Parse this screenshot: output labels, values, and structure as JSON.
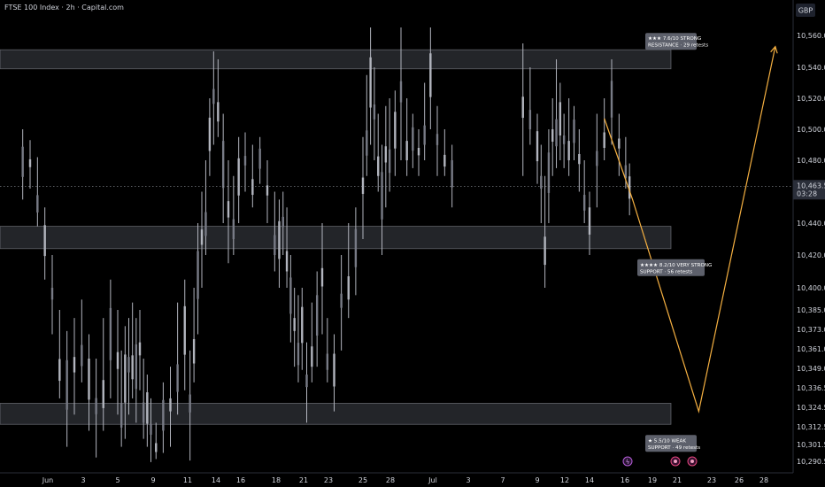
{
  "header": {
    "title": "FTSE 100 Index · 2h · Capital.com"
  },
  "currency": "GBP",
  "colors": {
    "background": "#000000",
    "candle": "#b2b5be",
    "projection": "#f5b041",
    "zone": "#5d606b",
    "label_bg": "#5d606b"
  },
  "price_axis": {
    "labels": [
      {
        "text": "10,560.0",
        "v": 10560.0
      },
      {
        "text": "10,540.0",
        "v": 10540.0
      },
      {
        "text": "10,520.0",
        "v": 10520.0
      },
      {
        "text": "10,500.0",
        "v": 10500.0
      },
      {
        "text": "10,480.0",
        "v": 10480.0
      },
      {
        "text": "10,440.0",
        "v": 10440.0
      },
      {
        "text": "10,420.0",
        "v": 10420.0
      },
      {
        "text": "10,400.0",
        "v": 10400.0
      },
      {
        "text": "10,385.0",
        "v": 10385.0
      },
      {
        "text": "10,373.0",
        "v": 10373.0
      },
      {
        "text": "10,361.0",
        "v": 10361.0
      },
      {
        "text": "10,349.0",
        "v": 10349.0
      },
      {
        "text": "10,336.5",
        "v": 10336.5
      },
      {
        "text": "10,324.5",
        "v": 10324.5
      },
      {
        "text": "10,312.5",
        "v": 10312.5
      },
      {
        "text": "10,301.5",
        "v": 10301.5
      },
      {
        "text": "10,290.5",
        "v": 10290.5
      }
    ],
    "current_price": "10,463.5",
    "countdown": "03:28"
  },
  "time_axis": {
    "labels": [
      {
        "text": "Jun",
        "d": "2025-06-01"
      },
      {
        "text": "3",
        "d": "2025-06-03"
      },
      {
        "text": "5",
        "d": "2025-06-05"
      },
      {
        "text": "9",
        "d": "2025-06-09"
      },
      {
        "text": "11",
        "d": "2025-06-11"
      },
      {
        "text": "14",
        "d": "2025-06-14"
      },
      {
        "text": "16",
        "d": "2025-06-16"
      },
      {
        "text": "18",
        "d": "2025-06-18"
      },
      {
        "text": "21",
        "d": "2025-06-21"
      },
      {
        "text": "23",
        "d": "2025-06-23"
      },
      {
        "text": "25",
        "d": "2025-06-25"
      },
      {
        "text": "28",
        "d": "2025-06-28"
      },
      {
        "text": "Jul",
        "d": "2025-07-01"
      },
      {
        "text": "3",
        "d": "2025-07-03"
      },
      {
        "text": "7",
        "d": "2025-07-07"
      },
      {
        "text": "9",
        "d": "2025-07-09"
      },
      {
        "text": "12",
        "d": "2025-07-12"
      },
      {
        "text": "14",
        "d": "2025-07-14"
      },
      {
        "text": "16",
        "d": "2025-07-16"
      },
      {
        "text": "19",
        "d": "2025-07-19"
      },
      {
        "text": "21",
        "d": "2025-07-21"
      },
      {
        "text": "23",
        "d": "2025-07-23"
      },
      {
        "text": "26",
        "d": "2025-07-26"
      },
      {
        "text": "28",
        "d": "2025-07-28"
      }
    ]
  },
  "zones": [
    {
      "kind": "resistance",
      "top": 10551,
      "bottom": 10539,
      "line1": "★★★ 7.6/10 STRONG",
      "line2": "RESISTANCE · 29 retests"
    },
    {
      "kind": "support",
      "top": 10438,
      "bottom": 10424,
      "line1": "★★★★ 8.2/10 VERY STRONG",
      "line2": "SUPPORT · 56 retests"
    },
    {
      "kind": "support",
      "top": 10327,
      "bottom": 10314,
      "line1": "★ 5.5/10 WEAK",
      "line2": "SUPPORT · 49 retests"
    }
  ],
  "chart_data": {
    "type": "candlestick",
    "title": "FTSE 100 Index · 2h · Capital.com",
    "y_unit": "GBP",
    "ylim": [
      10288,
      10565
    ],
    "xlim": [
      "2025-05-30T12:00",
      "2025-07-31T06:00"
    ],
    "current_price": 10463.5,
    "candles": [
      {
        "t": "2025-05-30T14:00",
        "low": 10455,
        "high": 10500
      },
      {
        "t": "2025-05-31T00:00",
        "low": 10462,
        "high": 10493
      },
      {
        "t": "2025-05-31T10:00",
        "low": 10438,
        "high": 10482
      },
      {
        "t": "2025-05-31T20:00",
        "low": 10405,
        "high": 10450
      },
      {
        "t": "2025-06-01T06:00",
        "low": 10370,
        "high": 10420
      },
      {
        "t": "2025-06-01T16:00",
        "low": 10330,
        "high": 10385
      },
      {
        "t": "2025-06-02T02:00",
        "low": 10300,
        "high": 10372
      },
      {
        "t": "2025-06-02T12:00",
        "low": 10320,
        "high": 10380
      },
      {
        "t": "2025-06-02T22:00",
        "low": 10340,
        "high": 10392
      },
      {
        "t": "2025-06-03T08:00",
        "low": 10310,
        "high": 10370
      },
      {
        "t": "2025-06-03T18:00",
        "low": 10293,
        "high": 10355
      },
      {
        "t": "2025-06-04T04:00",
        "low": 10310,
        "high": 10380
      },
      {
        "t": "2025-06-04T14:00",
        "low": 10330,
        "high": 10405
      },
      {
        "t": "2025-06-05T00:00",
        "low": 10320,
        "high": 10385
      },
      {
        "t": "2025-06-05T10:00",
        "low": 10300,
        "high": 10360
      },
      {
        "t": "2025-06-05T20:00",
        "low": 10305,
        "high": 10375
      },
      {
        "t": "2025-06-06T06:00",
        "low": 10320,
        "high": 10380
      },
      {
        "t": "2025-06-06T16:00",
        "low": 10330,
        "high": 10390
      },
      {
        "t": "2025-06-07T02:00",
        "low": 10315,
        "high": 10380
      },
      {
        "t": "2025-06-07T12:00",
        "low": 10335,
        "high": 10385
      },
      {
        "t": "2025-06-07T22:00",
        "low": 10305,
        "high": 10355
      },
      {
        "t": "2025-06-08T08:00",
        "low": 10300,
        "high": 10345
      },
      {
        "t": "2025-06-08T18:00",
        "low": 10290,
        "high": 10330
      },
      {
        "t": "2025-06-09T04:00",
        "low": 10292,
        "high": 10315
      },
      {
        "t": "2025-06-09T14:00",
        "low": 10296,
        "high": 10340
      },
      {
        "t": "2025-06-10T00:00",
        "low": 10300,
        "high": 10350
      },
      {
        "t": "2025-06-10T10:00",
        "low": 10320,
        "high": 10390
      },
      {
        "t": "2025-06-10T20:00",
        "low": 10335,
        "high": 10405
      },
      {
        "t": "2025-06-11T06:00",
        "low": 10291,
        "high": 10360
      },
      {
        "t": "2025-06-11T16:00",
        "low": 10340,
        "high": 10400
      },
      {
        "t": "2025-06-12T02:00",
        "low": 10370,
        "high": 10440
      },
      {
        "t": "2025-06-12T12:00",
        "low": 10400,
        "high": 10460
      },
      {
        "t": "2025-06-12T22:00",
        "low": 10420,
        "high": 10480
      },
      {
        "t": "2025-06-13T08:00",
        "low": 10470,
        "high": 10520
      },
      {
        "t": "2025-06-13T18:00",
        "low": 10490,
        "high": 10550
      },
      {
        "t": "2025-06-14T04:00",
        "low": 10495,
        "high": 10545
      },
      {
        "t": "2025-06-14T14:00",
        "low": 10440,
        "high": 10510
      },
      {
        "t": "2025-06-15T00:00",
        "low": 10415,
        "high": 10480
      },
      {
        "t": "2025-06-15T10:00",
        "low": 10420,
        "high": 10470
      },
      {
        "t": "2025-06-15T20:00",
        "low": 10440,
        "high": 10495
      },
      {
        "t": "2025-06-16T06:00",
        "low": 10460,
        "high": 10498
      },
      {
        "t": "2025-06-16T16:00",
        "low": 10450,
        "high": 10490
      },
      {
        "t": "2025-06-17T02:00",
        "low": 10465,
        "high": 10495
      },
      {
        "t": "2025-06-17T12:00",
        "low": 10440,
        "high": 10480
      },
      {
        "t": "2025-06-17T22:00",
        "low": 10410,
        "high": 10460
      },
      {
        "t": "2025-06-18T08:00",
        "low": 10400,
        "high": 10455
      },
      {
        "t": "2025-06-18T18:00",
        "low": 10420,
        "high": 10460
      },
      {
        "t": "2025-06-19T04:00",
        "low": 10400,
        "high": 10450
      },
      {
        "t": "2025-06-19T14:00",
        "low": 10365,
        "high": 10420
      },
      {
        "t": "2025-06-20T00:00",
        "low": 10350,
        "high": 10400
      },
      {
        "t": "2025-06-20T10:00",
        "low": 10340,
        "high": 10395
      },
      {
        "t": "2025-06-20T20:00",
        "low": 10348,
        "high": 10400
      },
      {
        "t": "2025-06-21T06:00",
        "low": 10315,
        "high": 10365
      },
      {
        "t": "2025-06-21T16:00",
        "low": 10340,
        "high": 10390
      },
      {
        "t": "2025-06-22T02:00",
        "low": 10350,
        "high": 10410
      },
      {
        "t": "2025-06-22T12:00",
        "low": 10370,
        "high": 10440
      },
      {
        "t": "2025-06-22T22:00",
        "low": 10340,
        "high": 10380
      },
      {
        "t": "2025-06-23T08:00",
        "low": 10322,
        "high": 10370
      },
      {
        "t": "2025-06-23T18:00",
        "low": 10360,
        "high": 10420
      },
      {
        "t": "2025-06-24T04:00",
        "low": 10380,
        "high": 10440
      },
      {
        "t": "2025-06-24T14:00",
        "low": 10395,
        "high": 10450
      },
      {
        "t": "2025-06-25T00:00",
        "low": 10430,
        "high": 10495
      },
      {
        "t": "2025-06-25T10:00",
        "low": 10470,
        "high": 10535
      },
      {
        "t": "2025-06-25T20:00",
        "low": 10490,
        "high": 10565
      },
      {
        "t": "2025-06-26T06:00",
        "low": 10480,
        "high": 10540
      },
      {
        "t": "2025-06-26T16:00",
        "low": 10460,
        "high": 10510
      },
      {
        "t": "2025-06-27T02:00",
        "low": 10420,
        "high": 10490
      },
      {
        "t": "2025-06-27T12:00",
        "low": 10450,
        "high": 10515
      },
      {
        "t": "2025-06-27T22:00",
        "low": 10460,
        "high": 10520
      },
      {
        "t": "2025-06-28T08:00",
        "low": 10470,
        "high": 10525
      },
      {
        "t": "2025-06-28T18:00",
        "low": 10480,
        "high": 10565
      },
      {
        "t": "2025-06-29T04:00",
        "low": 10470,
        "high": 10520
      },
      {
        "t": "2025-06-29T14:00",
        "low": 10475,
        "high": 10510
      },
      {
        "t": "2025-06-30T00:00",
        "low": 10470,
        "high": 10500
      },
      {
        "t": "2025-06-30T10:00",
        "low": 10480,
        "high": 10530
      },
      {
        "t": "2025-06-30T20:00",
        "low": 10500,
        "high": 10565
      },
      {
        "t": "2025-07-01T06:00",
        "low": 10470,
        "high": 10515
      },
      {
        "t": "2025-07-01T16:00",
        "low": 10470,
        "high": 10500
      },
      {
        "t": "2025-07-02T02:00",
        "low": 10450,
        "high": 10490
      },
      {
        "t": "2025-07-08T04:00",
        "low": 10470,
        "high": 10555
      },
      {
        "t": "2025-07-08T14:00",
        "low": 10490,
        "high": 10540
      },
      {
        "t": "2025-07-09T00:00",
        "low": 10465,
        "high": 10510
      },
      {
        "t": "2025-07-09T10:00",
        "low": 10440,
        "high": 10490
      },
      {
        "t": "2025-07-09T20:00",
        "low": 10400,
        "high": 10470
      },
      {
        "t": "2025-07-10T06:00",
        "low": 10440,
        "high": 10500
      },
      {
        "t": "2025-07-10T16:00",
        "low": 10470,
        "high": 10520
      },
      {
        "t": "2025-07-11T02:00",
        "low": 10475,
        "high": 10545
      },
      {
        "t": "2025-07-11T12:00",
        "low": 10480,
        "high": 10530
      },
      {
        "t": "2025-07-11T22:00",
        "low": 10475,
        "high": 10510
      },
      {
        "t": "2025-07-12T08:00",
        "low": 10470,
        "high": 10520
      },
      {
        "t": "2025-07-12T18:00",
        "low": 10480,
        "high": 10515
      },
      {
        "t": "2025-07-13T04:00",
        "low": 10460,
        "high": 10500
      },
      {
        "t": "2025-07-13T14:00",
        "low": 10440,
        "high": 10480
      },
      {
        "t": "2025-07-14T00:00",
        "low": 10420,
        "high": 10460
      },
      {
        "t": "2025-07-14T10:00",
        "low": 10450,
        "high": 10510
      },
      {
        "t": "2025-07-14T20:00",
        "low": 10480,
        "high": 10520
      },
      {
        "t": "2025-07-15T06:00",
        "low": 10490,
        "high": 10545
      },
      {
        "t": "2025-07-15T16:00",
        "low": 10470,
        "high": 10510
      },
      {
        "t": "2025-07-16T02:00",
        "low": 10462,
        "high": 10495
      },
      {
        "t": "2025-07-16T12:00",
        "low": 10445,
        "high": 10478
      }
    ],
    "projection": {
      "type": "line",
      "points": [
        {
          "t": "2025-07-14T20:00",
          "v": 10507
        },
        {
          "t": "2025-07-16T20:00",
          "v": 10455
        },
        {
          "t": "2025-07-22T06:00",
          "v": 10322
        },
        {
          "t": "2025-07-28T22:00",
          "v": 10553
        }
      ],
      "arrow": true
    }
  }
}
